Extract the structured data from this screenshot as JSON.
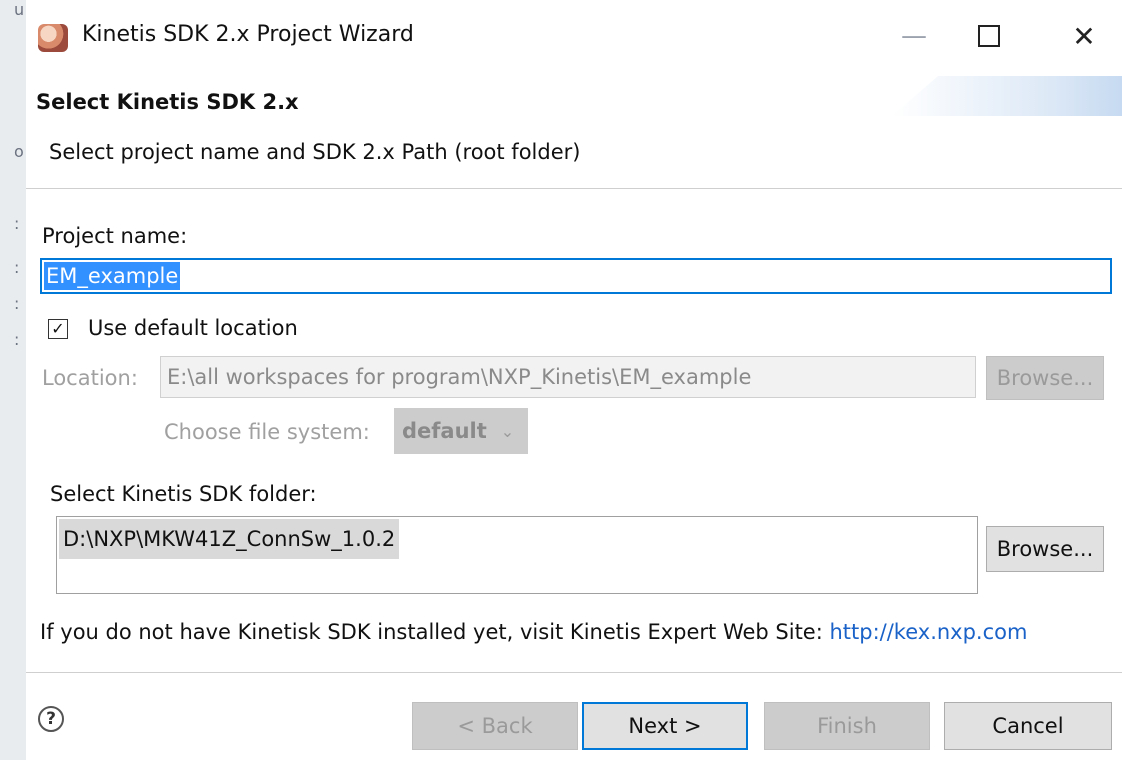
{
  "window": {
    "title": "Kinetis SDK 2.x Project Wizard",
    "controls": {
      "minimize": "—",
      "close": "✕"
    }
  },
  "banner": {
    "title": "Select Kinetis SDK 2.x",
    "subtitle": "Select project name and SDK 2.x Path (root folder)"
  },
  "project": {
    "name_label": "Project name:",
    "name_value": "EM_example"
  },
  "location": {
    "use_default_label": "Use default location",
    "use_default_checked": true,
    "check_glyph": "✓",
    "location_label": "Location:",
    "location_value": "E:\\all workspaces for program\\NXP_Kinetis\\EM_example",
    "browse_label": "Browse...",
    "file_system_label": "Choose file system:",
    "file_system_value": "default",
    "chevron": "⌄"
  },
  "sdk": {
    "folder_label": "Select Kinetis SDK folder:",
    "folder_value": "D:\\NXP\\MKW41Z_ConnSw_1.0.2",
    "browse_label": "Browse..."
  },
  "info": {
    "text": "If you do not have Kinetisk SDK installed yet, visit Kinetis Expert Web Site: ",
    "link_text": "http://kex.nxp.com"
  },
  "footer": {
    "help": "?",
    "back_label": "< Back",
    "next_label": "Next >",
    "finish_label": "Finish",
    "cancel_label": "Cancel"
  },
  "background": {
    "marks": [
      "u",
      "o",
      ":",
      ":",
      ":",
      ":"
    ]
  },
  "colors": {
    "accent": "#0078d7",
    "selection": "#3390ff",
    "link": "#1a62c8",
    "disabled_text": "#a0a0a0"
  }
}
